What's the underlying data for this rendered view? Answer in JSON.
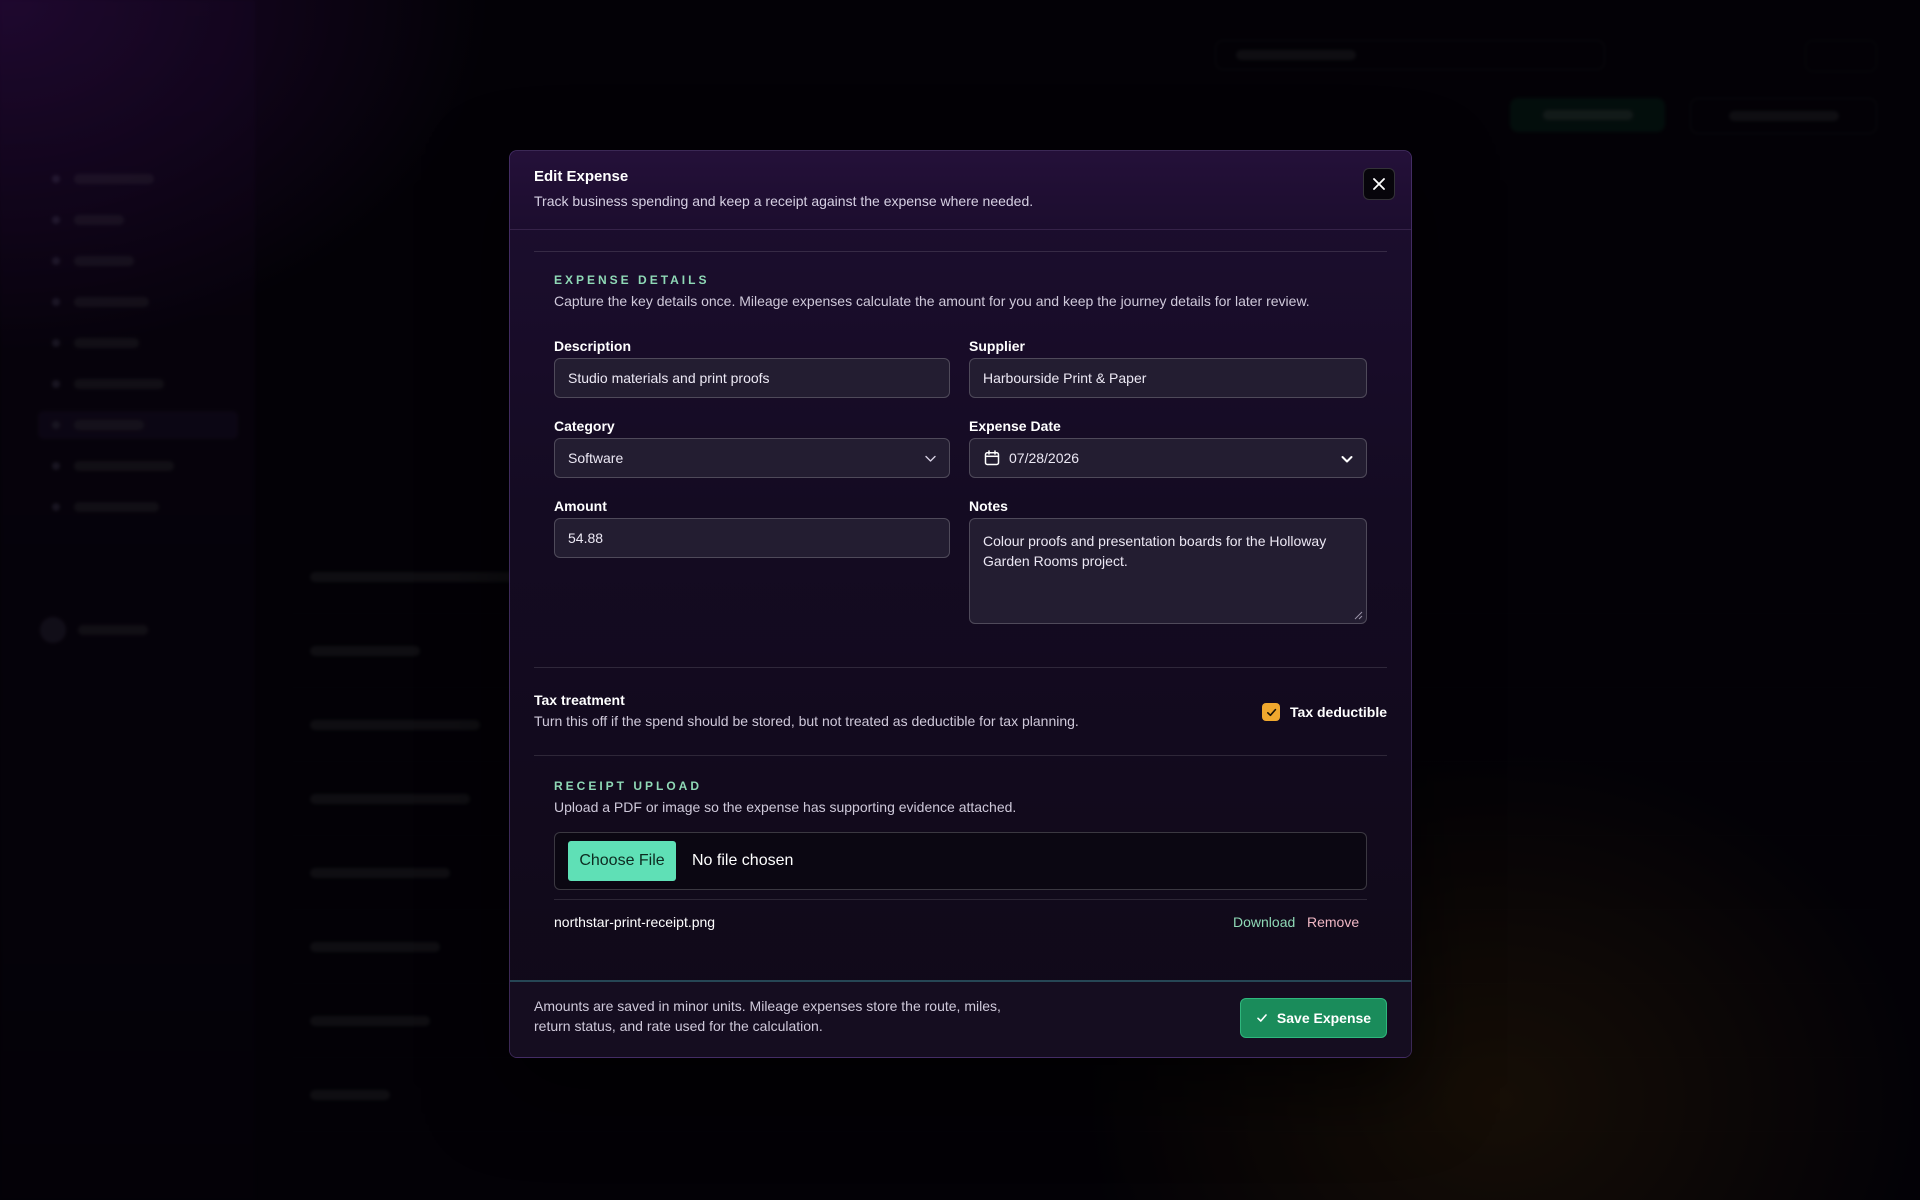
{
  "modal": {
    "title": "Edit Expense",
    "subtitle": "Track business spending and keep a receipt against the expense where needed."
  },
  "details": {
    "section_label": "EXPENSE DETAILS",
    "section_desc": "Capture the key details once. Mileage expenses calculate the amount for you and keep the journey details for later review.",
    "description": {
      "label": "Description",
      "value": "Studio materials and print proofs"
    },
    "supplier": {
      "label": "Supplier",
      "value": "Harbourside Print & Paper"
    },
    "category": {
      "label": "Category",
      "value": "Software"
    },
    "expense_date": {
      "label": "Expense Date",
      "value": "07/28/2026"
    },
    "amount": {
      "label": "Amount",
      "value": "54.88"
    },
    "notes": {
      "label": "Notes",
      "value": "Colour proofs and presentation boards for the Holloway Garden Rooms project."
    }
  },
  "tax": {
    "title": "Tax treatment",
    "desc": "Turn this off if the spend should be stored, but not treated as deductible for tax planning.",
    "checkbox_label": "Tax deductible",
    "checked": true
  },
  "receipt": {
    "section_label": "RECEIPT UPLOAD",
    "section_desc": "Upload a PDF or image so the expense has supporting evidence attached.",
    "choose_label": "Choose File",
    "no_file_label": "No file chosen",
    "file_name": "northstar-print-receipt.png",
    "download_label": "Download",
    "remove_label": "Remove"
  },
  "footer": {
    "note": "Amounts are saved in minor units. Mileage expenses store the route, miles, return status, and rate used for the calculation.",
    "save_label": "Save Expense"
  },
  "colors": {
    "accent_green": "#1a8c5b",
    "section_label": "#8fd9b6",
    "checkbox": "#f0a82e",
    "choose_file": "#5fe0b6"
  }
}
